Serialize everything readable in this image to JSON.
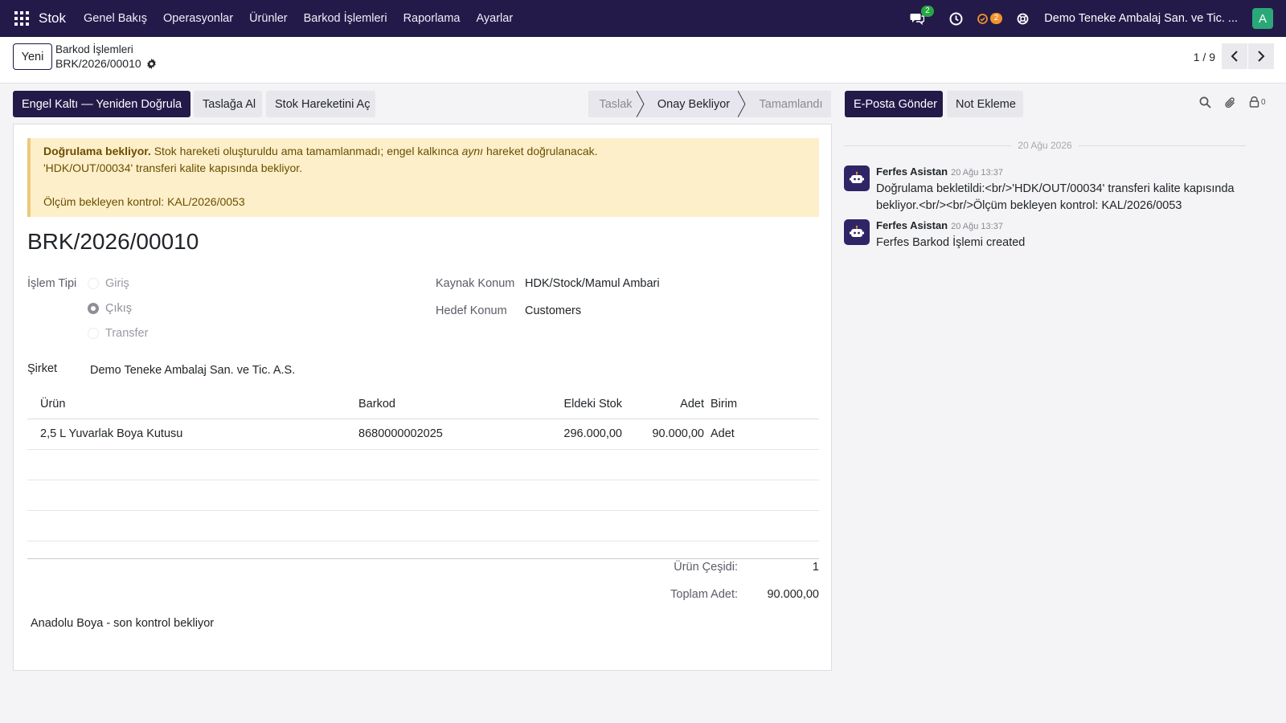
{
  "navbar": {
    "app_name": "Stok",
    "menu": [
      "Genel Bakış",
      "Operasyonlar",
      "Ürünler",
      "Barkod İşlemleri",
      "Raporlama",
      "Ayarlar"
    ],
    "messages_badge": "2",
    "activities_badge": "2",
    "company": "Demo Teneke Ambalaj San. ve Tic. ...",
    "avatar_letter": "A"
  },
  "control_panel": {
    "new_label": "Yeni",
    "breadcrumb_parent": "Barkod İşlemleri",
    "breadcrumb_current": "BRK/2026/00010",
    "pager": "1 / 9"
  },
  "actions": {
    "primary": "Engel Kaltı — Yeniden Doğrula",
    "draft": "Taslağa Al",
    "open_move": "Stok Hareketini Aç"
  },
  "status": {
    "stages": [
      "Taslak",
      "Onay Bekliyor",
      "Tamamlandı"
    ],
    "active": "Onay Bekliyor"
  },
  "alert": {
    "bold": "Doğrulama bekliyor.",
    "line1_a": " Stok hareketi oluşturuldu ama tamamlanmadı; engel kalkınca ",
    "line1_em": "aynı",
    "line1_b": " hareket doğrulanacak.",
    "line2": "'HDK/OUT/00034' transferi kalite kapısında bekliyor.",
    "line3": "Ölçüm bekleyen kontrol: KAL/2026/0053"
  },
  "record": {
    "title": "BRK/2026/00010",
    "operation_type_label": "İşlem Tipi",
    "operation_types": [
      "Giriş",
      "Çıkış",
      "Transfer"
    ],
    "operation_type_selected": "Çıkış",
    "source_label": "Kaynak Konum",
    "source_value": "HDK/Stock/Mamul Ambari",
    "dest_label": "Hedef Konum",
    "dest_value": "Customers",
    "company_label": "Şirket",
    "company_value": "Demo Teneke Ambalaj San. ve Tic. A.S."
  },
  "table": {
    "headers": {
      "product": "Ürün",
      "barcode": "Barkod",
      "stock": "Eldeki Stok",
      "qty": "Adet",
      "uom": "Birim"
    },
    "rows": [
      {
        "product": "2,5 L Yuvarlak Boya Kutusu",
        "barcode": "8680000002025",
        "stock": "296.000,00",
        "qty": "90.000,00",
        "uom": "Adet"
      }
    ],
    "totals": {
      "variety_label": "Ürün Çeşidi:",
      "variety_value": "1",
      "qty_label": "Toplam Adet:",
      "qty_value": "90.000,00"
    }
  },
  "note": "Anadolu Boya - son kontrol bekliyor",
  "chatter": {
    "send_email": "E-Posta Gönder",
    "log_note": "Not Ekleme",
    "followers_count": "0",
    "date_separator": "20 Ağu 2026",
    "messages": [
      {
        "author": "Ferfes Asistan",
        "time": "20 Ağu 13:37",
        "body": "Doğrulama bekletildi:<br/>'HDK/OUT/00034' transferi kalite kapısında bekliyor.<br/><br/>Ölçüm bekleyen kontrol: KAL/2026/0053"
      },
      {
        "author": "Ferfes Asistan",
        "time": "20 Ağu 13:37",
        "body": "Ferfes Barkod İşlemi created"
      }
    ]
  },
  "colors": {
    "navbar": "#241a4a",
    "primary": "#241a4a",
    "alert_bg": "#fdefc9",
    "badge_green": "#28a745",
    "badge_orange": "#f0932b",
    "avatar": "#2aa877"
  },
  "icons": [
    "apps-grid-icon",
    "chat-icon",
    "clock-icon",
    "activity-icon",
    "support-icon",
    "gear-icon",
    "chevron-left-icon",
    "chevron-right-icon",
    "search-icon",
    "paperclip-icon",
    "follower-icon",
    "robot-icon"
  ]
}
